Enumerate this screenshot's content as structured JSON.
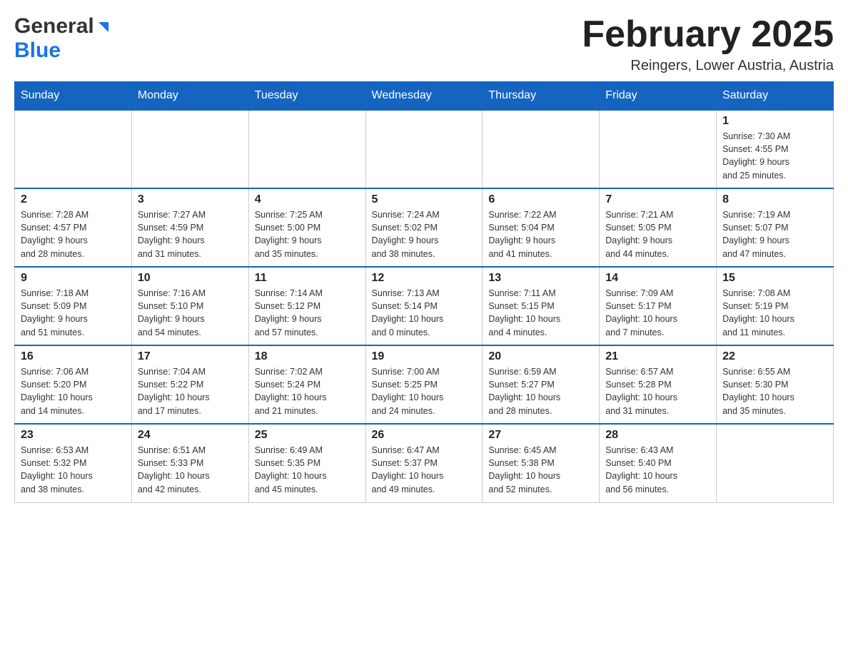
{
  "header": {
    "logo_general": "General",
    "logo_blue": "Blue",
    "month_title": "February 2025",
    "location": "Reingers, Lower Austria, Austria"
  },
  "days_of_week": [
    "Sunday",
    "Monday",
    "Tuesday",
    "Wednesday",
    "Thursday",
    "Friday",
    "Saturday"
  ],
  "weeks": [
    {
      "days": [
        {
          "num": "",
          "info": ""
        },
        {
          "num": "",
          "info": ""
        },
        {
          "num": "",
          "info": ""
        },
        {
          "num": "",
          "info": ""
        },
        {
          "num": "",
          "info": ""
        },
        {
          "num": "",
          "info": ""
        },
        {
          "num": "1",
          "info": "Sunrise: 7:30 AM\nSunset: 4:55 PM\nDaylight: 9 hours\nand 25 minutes."
        }
      ]
    },
    {
      "days": [
        {
          "num": "2",
          "info": "Sunrise: 7:28 AM\nSunset: 4:57 PM\nDaylight: 9 hours\nand 28 minutes."
        },
        {
          "num": "3",
          "info": "Sunrise: 7:27 AM\nSunset: 4:59 PM\nDaylight: 9 hours\nand 31 minutes."
        },
        {
          "num": "4",
          "info": "Sunrise: 7:25 AM\nSunset: 5:00 PM\nDaylight: 9 hours\nand 35 minutes."
        },
        {
          "num": "5",
          "info": "Sunrise: 7:24 AM\nSunset: 5:02 PM\nDaylight: 9 hours\nand 38 minutes."
        },
        {
          "num": "6",
          "info": "Sunrise: 7:22 AM\nSunset: 5:04 PM\nDaylight: 9 hours\nand 41 minutes."
        },
        {
          "num": "7",
          "info": "Sunrise: 7:21 AM\nSunset: 5:05 PM\nDaylight: 9 hours\nand 44 minutes."
        },
        {
          "num": "8",
          "info": "Sunrise: 7:19 AM\nSunset: 5:07 PM\nDaylight: 9 hours\nand 47 minutes."
        }
      ]
    },
    {
      "days": [
        {
          "num": "9",
          "info": "Sunrise: 7:18 AM\nSunset: 5:09 PM\nDaylight: 9 hours\nand 51 minutes."
        },
        {
          "num": "10",
          "info": "Sunrise: 7:16 AM\nSunset: 5:10 PM\nDaylight: 9 hours\nand 54 minutes."
        },
        {
          "num": "11",
          "info": "Sunrise: 7:14 AM\nSunset: 5:12 PM\nDaylight: 9 hours\nand 57 minutes."
        },
        {
          "num": "12",
          "info": "Sunrise: 7:13 AM\nSunset: 5:14 PM\nDaylight: 10 hours\nand 0 minutes."
        },
        {
          "num": "13",
          "info": "Sunrise: 7:11 AM\nSunset: 5:15 PM\nDaylight: 10 hours\nand 4 minutes."
        },
        {
          "num": "14",
          "info": "Sunrise: 7:09 AM\nSunset: 5:17 PM\nDaylight: 10 hours\nand 7 minutes."
        },
        {
          "num": "15",
          "info": "Sunrise: 7:08 AM\nSunset: 5:19 PM\nDaylight: 10 hours\nand 11 minutes."
        }
      ]
    },
    {
      "days": [
        {
          "num": "16",
          "info": "Sunrise: 7:06 AM\nSunset: 5:20 PM\nDaylight: 10 hours\nand 14 minutes."
        },
        {
          "num": "17",
          "info": "Sunrise: 7:04 AM\nSunset: 5:22 PM\nDaylight: 10 hours\nand 17 minutes."
        },
        {
          "num": "18",
          "info": "Sunrise: 7:02 AM\nSunset: 5:24 PM\nDaylight: 10 hours\nand 21 minutes."
        },
        {
          "num": "19",
          "info": "Sunrise: 7:00 AM\nSunset: 5:25 PM\nDaylight: 10 hours\nand 24 minutes."
        },
        {
          "num": "20",
          "info": "Sunrise: 6:59 AM\nSunset: 5:27 PM\nDaylight: 10 hours\nand 28 minutes."
        },
        {
          "num": "21",
          "info": "Sunrise: 6:57 AM\nSunset: 5:28 PM\nDaylight: 10 hours\nand 31 minutes."
        },
        {
          "num": "22",
          "info": "Sunrise: 6:55 AM\nSunset: 5:30 PM\nDaylight: 10 hours\nand 35 minutes."
        }
      ]
    },
    {
      "days": [
        {
          "num": "23",
          "info": "Sunrise: 6:53 AM\nSunset: 5:32 PM\nDaylight: 10 hours\nand 38 minutes."
        },
        {
          "num": "24",
          "info": "Sunrise: 6:51 AM\nSunset: 5:33 PM\nDaylight: 10 hours\nand 42 minutes."
        },
        {
          "num": "25",
          "info": "Sunrise: 6:49 AM\nSunset: 5:35 PM\nDaylight: 10 hours\nand 45 minutes."
        },
        {
          "num": "26",
          "info": "Sunrise: 6:47 AM\nSunset: 5:37 PM\nDaylight: 10 hours\nand 49 minutes."
        },
        {
          "num": "27",
          "info": "Sunrise: 6:45 AM\nSunset: 5:38 PM\nDaylight: 10 hours\nand 52 minutes."
        },
        {
          "num": "28",
          "info": "Sunrise: 6:43 AM\nSunset: 5:40 PM\nDaylight: 10 hours\nand 56 minutes."
        },
        {
          "num": "",
          "info": ""
        }
      ]
    }
  ]
}
